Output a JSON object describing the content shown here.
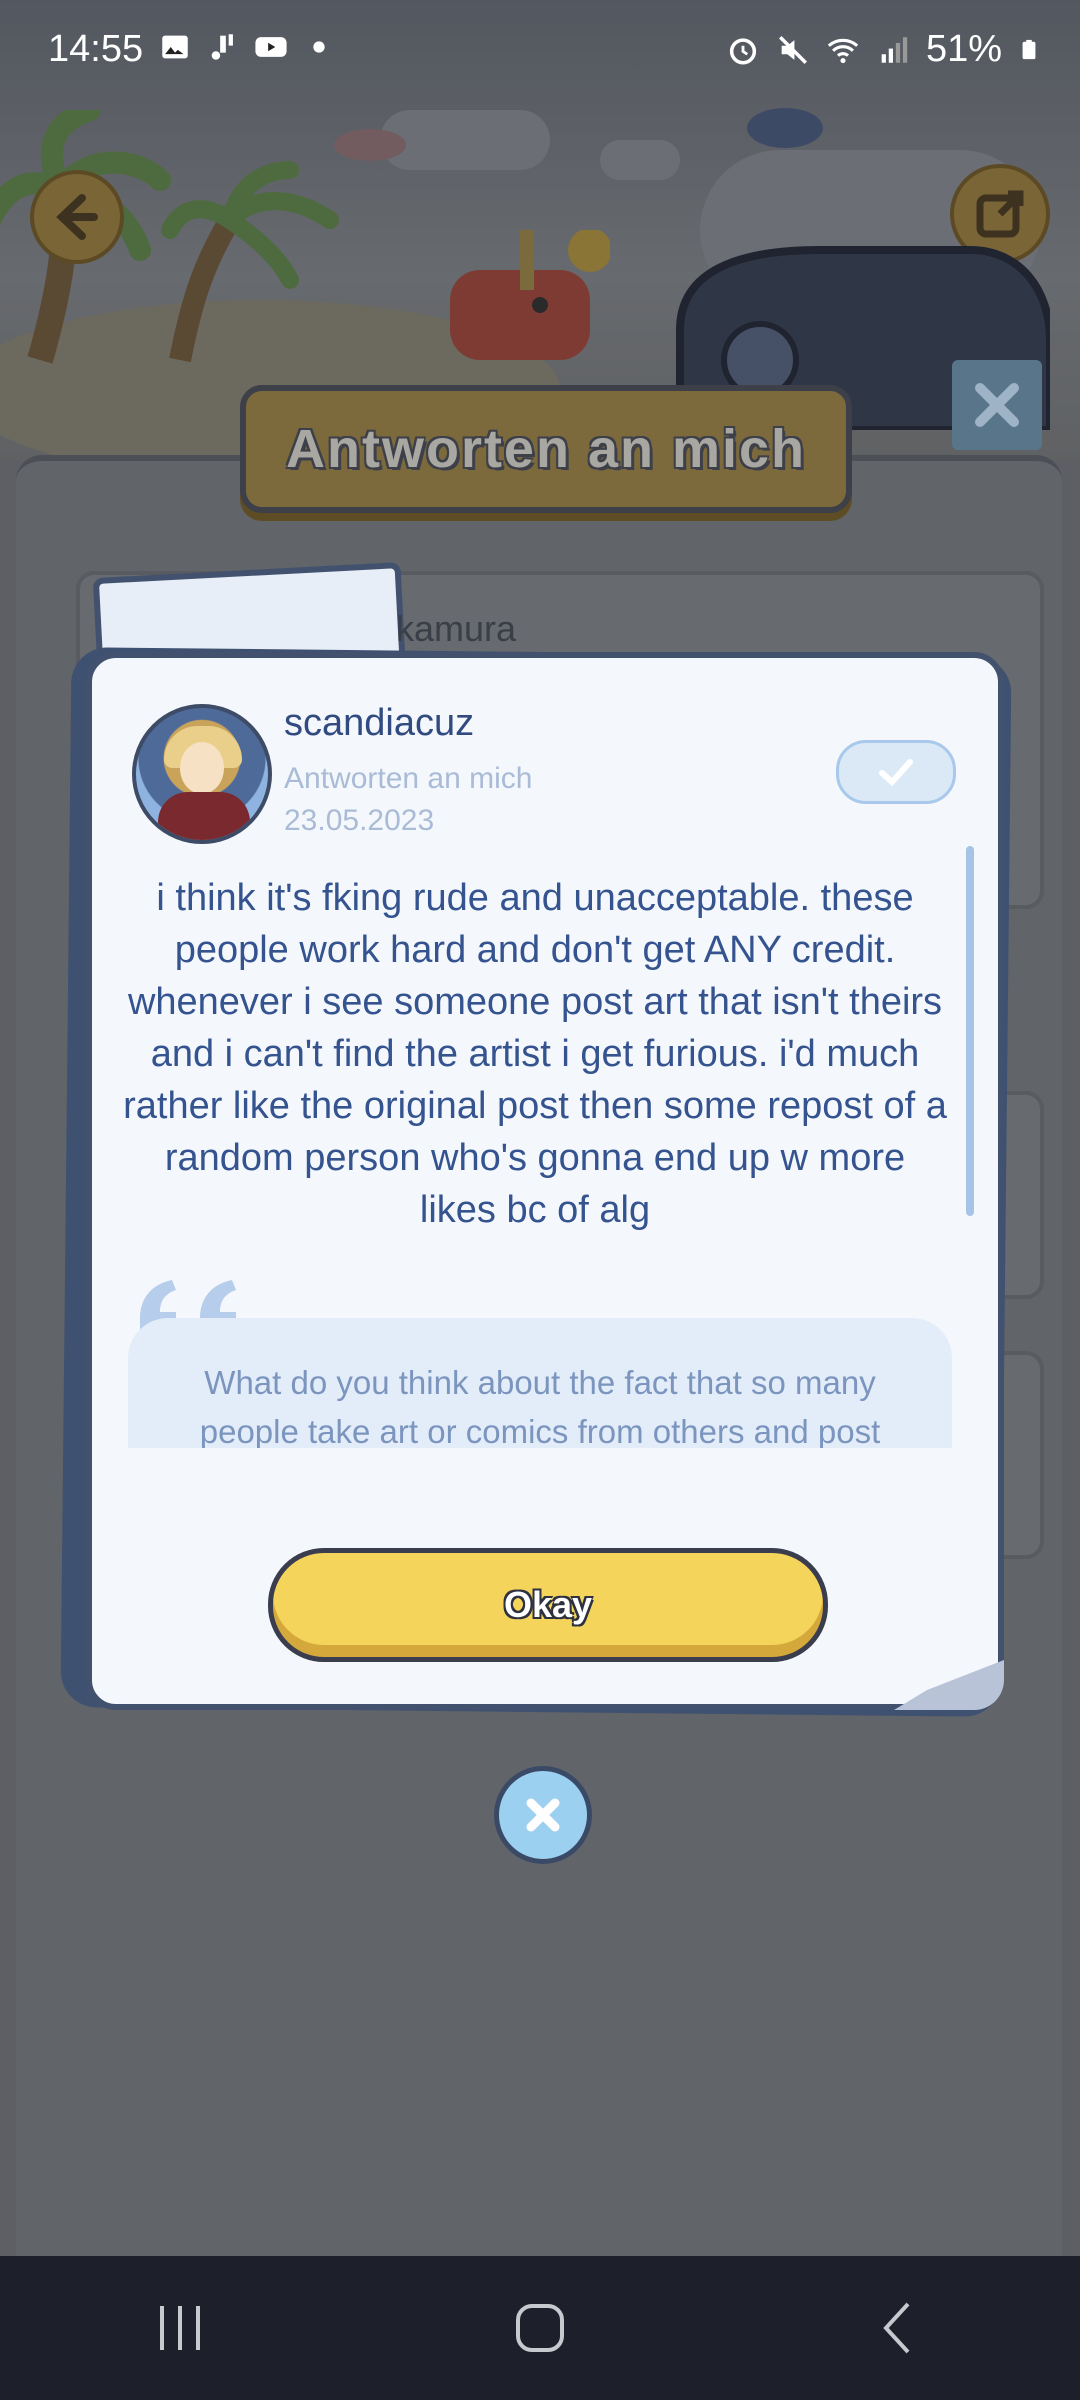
{
  "status_bar": {
    "time": "14:55",
    "battery": "51%",
    "left_icons": [
      "gallery-icon",
      "notification-icon",
      "youtube-icon",
      "dot-icon"
    ],
    "right_icons": [
      "alarm-icon",
      "mute-icon",
      "wifi-icon",
      "signal-icon",
      "battery-icon"
    ]
  },
  "header": {
    "title": "Antworten an mich"
  },
  "background_list": {
    "partial_name": "kamura"
  },
  "dialog": {
    "username": "scandiacuz",
    "subtitle": "Antworten an mich",
    "date": "23.05.2023",
    "message": "i think it's fking rude and unacceptable. these people work hard and don't get ANY credit. whenever i see someone post art that isn't theirs and i can't find the artist i get furious. i'd much rather like the original post then some repost of a random person who's gonna end up w more likes bc of alg",
    "quote": "What do you think about the fact that so many people take art or comics from others and post",
    "ok_label": "Okay"
  },
  "colors": {
    "accent_yellow": "#f5d45b",
    "text_blue": "#34538f",
    "dialog_border": "#42526e"
  }
}
